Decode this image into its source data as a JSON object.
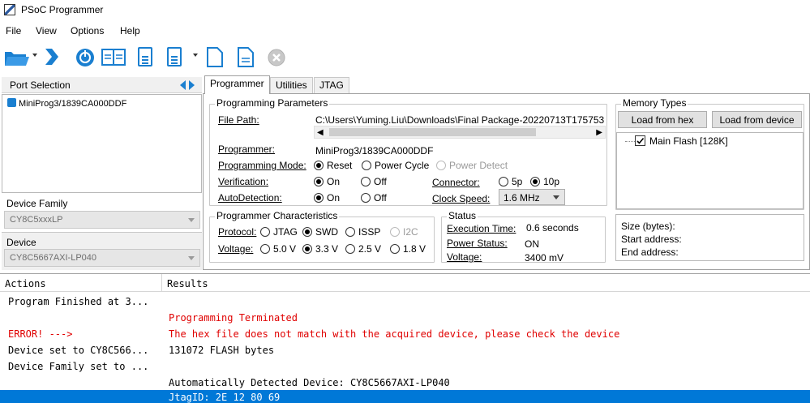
{
  "window": {
    "title": "PSoC Programmer"
  },
  "menu": [
    "File",
    "View",
    "Options",
    "Help"
  ],
  "toolbar": {
    "icons": [
      "open-folder-icon",
      "dropdown-caret-icon",
      "program-icon",
      "power-icon",
      "verify-icon",
      "checksum-icon",
      "erase-icon",
      "read-icon",
      "dropdown-caret-icon",
      "blank-document-icon",
      "document-icon",
      "stop-icon"
    ]
  },
  "left": {
    "port_selection_label": "Port Selection",
    "port_item": "MiniProg3/1839CA000DDF",
    "device_family_label": "Device Family",
    "device_family_value": "CY8C5xxxLP",
    "device_label": "Device",
    "device_value": "CY8C5667AXI-LP040"
  },
  "tabs": [
    "Programmer",
    "Utilities",
    "JTAG"
  ],
  "prog_params": {
    "legend": "Programming Parameters",
    "file_path_label": "File Path:",
    "file_path_value": "C:\\Users\\Yuming.Liu\\Downloads\\Final Package-20220713T175753",
    "programmer_label": "Programmer:",
    "programmer_value": "MiniProg3/1839CA000DDF",
    "mode_label": "Programming Mode:",
    "mode_reset": "Reset",
    "mode_power_cycle": "Power Cycle",
    "mode_power_detect": "Power Detect",
    "verification_label": "Verification:",
    "on": "On",
    "off": "Off",
    "autodetection_label": "AutoDetection:",
    "connector_label": "Connector:",
    "connector_5p": "5p",
    "connector_10p": "10p",
    "clock_label": "Clock Speed:",
    "clock_value": "1.6 MHz"
  },
  "memory": {
    "legend": "Memory Types",
    "load_hex": "Load from hex",
    "load_device": "Load from device",
    "main_flash": "Main Flash [128K]",
    "size_label": "Size (bytes):",
    "start_label": "Start address:",
    "end_label": "End address:"
  },
  "prog_char": {
    "legend": "Programmer Characteristics",
    "protocol_label": "Protocol:",
    "jtag": "JTAG",
    "swd": "SWD",
    "issp": "ISSP",
    "i2c": "I2C",
    "voltage_label": "Voltage:",
    "v50": "5.0 V",
    "v33": "3.3 V",
    "v25": "2.5 V",
    "v18": "1.8 V"
  },
  "status": {
    "legend": "Status",
    "exec_label": "Execution Time:",
    "exec_value": "0.6 seconds",
    "power_label": "Power Status:",
    "power_value": "ON",
    "voltage_label": "Voltage:",
    "voltage_value": "3400 mV"
  },
  "log": {
    "col_actions": "Actions",
    "col_results": "Results",
    "rows": [
      {
        "action": "Program Finished at 3...",
        "result": ""
      },
      {
        "action": "",
        "result": "Programming Terminated"
      },
      {
        "action": "ERROR! --->",
        "result": "The hex file does not match with the acquired device, please check the device"
      },
      {
        "action": "Device set to CY8C566...",
        "result": "131072  FLASH bytes"
      },
      {
        "action": "Device Family set to ...",
        "result": ""
      },
      {
        "action": "",
        "result": "Automatically Detected Device: CY8C5667AXI-LP040"
      },
      {
        "action": "",
        "result": "JtagID: 2E 12 80 69"
      }
    ]
  },
  "colors": {
    "selection": "#0078d7",
    "error": "#e00000",
    "accent": "#1a7fd0"
  }
}
